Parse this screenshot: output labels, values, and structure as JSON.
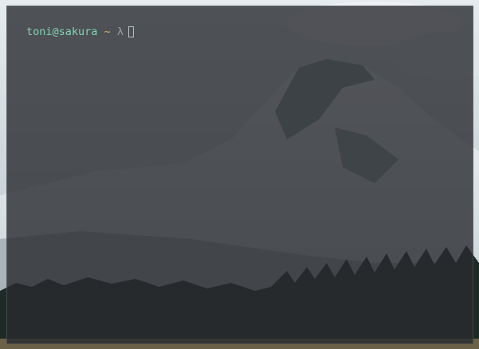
{
  "terminal": {
    "prompt": {
      "user_host": "toni@sakura",
      "path": "~",
      "symbol": "λ"
    }
  },
  "colors": {
    "user_host": "#7fd6b0",
    "path": "#d9b25e",
    "symbol": "#9aa2a6",
    "terminal_bg": "#282b2f"
  },
  "wallpaper": {
    "subject": "snow-capped-mountain-with-pine-forest"
  }
}
